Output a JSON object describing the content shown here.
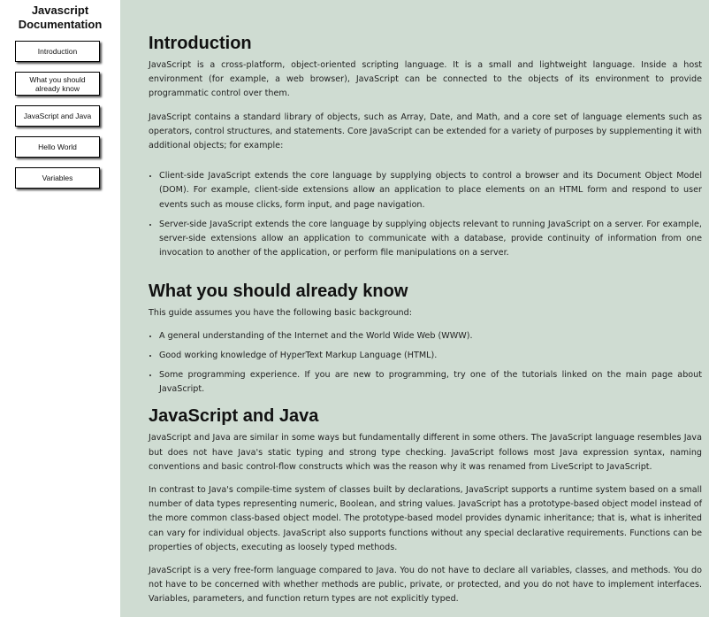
{
  "nav": {
    "title": "Javascript Documentation",
    "links": [
      "Introduction",
      "What you should already know",
      "JavaScript and Java",
      "Hello World",
      "Variables"
    ]
  },
  "sections": {
    "introduction": {
      "title": "Introduction",
      "p1": "JavaScript is a cross-platform, object-oriented scripting language. It is a small and lightweight language. Inside a host environment (for example, a web browser), JavaScript can be connected to the objects of its environment to provide programmatic control over them.",
      "p2": "JavaScript contains a standard library of objects, such as Array, Date, and Math, and a core set of language elements such as operators, control structures, and statements. Core JavaScript can be extended for a variety of purposes by supplementing it with additional objects; for example:",
      "list": [
        "Client-side JavaScript extends the core language by supplying objects to control a browser and its Document Object Model (DOM). For example, client-side extensions allow an application to place elements on an HTML form and respond to user events such as mouse clicks, form input, and page navigation.",
        "Server-side JavaScript extends the core language by supplying objects relevant to running JavaScript on a server. For example, server-side extensions allow an application to communicate with a database, provide continuity of information from one invocation to another of the application, or perform file manipulations on a server."
      ]
    },
    "already_know": {
      "title": "What you should already know",
      "p1": "This guide assumes you have the following basic background:",
      "list": [
        "A general understanding of the Internet and the World Wide Web (WWW).",
        "Good working knowledge of HyperText Markup Language (HTML).",
        "Some programming experience. If you are new to programming, try one of the tutorials linked on the main page about JavaScript."
      ]
    },
    "js_and_java": {
      "title": "JavaScript and Java",
      "p1": "JavaScript and Java are similar in some ways but fundamentally different in some others. The JavaScript language resembles Java but does not have Java's static typing and strong type checking. JavaScript follows most Java expression syntax, naming conventions and basic control-flow constructs which was the reason why it was renamed from LiveScript to JavaScript.",
      "p2": "In contrast to Java's compile-time system of classes built by declarations, JavaScript supports a runtime system based on a small number of data types representing numeric, Boolean, and string values. JavaScript has a prototype-based object model instead of the more common class-based object model. The prototype-based model provides dynamic inheritance; that is, what is inherited can vary for individual objects. JavaScript also supports functions without any special declarative requirements. Functions can be properties of objects, executing as loosely typed methods.",
      "p3": "JavaScript is a very free-form language compared to Java. You do not have to declare all variables, classes, and methods. You do not have to be concerned with whether methods are public, private, or protected, and you do not have to implement interfaces. Variables, parameters, and function return types are not explicitly typed."
    }
  }
}
